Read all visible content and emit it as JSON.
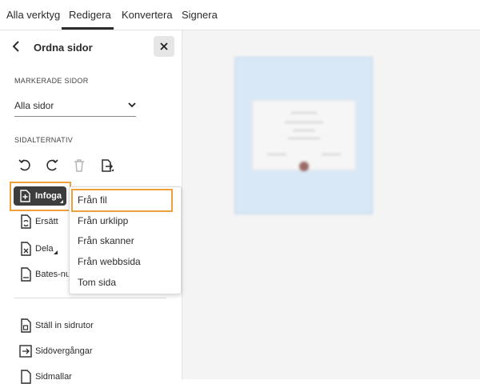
{
  "topnav": {
    "tabs": [
      {
        "label": "Alla verktyg"
      },
      {
        "label": "Redigera"
      },
      {
        "label": "Konvertera"
      },
      {
        "label": "Signera"
      }
    ],
    "active_tab": "Redigera"
  },
  "panel": {
    "title": "Ordna sidor",
    "selected_pages_label": "MARKERADE SIDOR",
    "selected_pages_value": "Alla sidor",
    "page_options_label": "SIDALTERNATIV",
    "tools": {
      "insert": "Infoga",
      "replace": "Ersätt",
      "split": "Dela",
      "bates": "Bates-nu",
      "page_boxes": "Ställ in sidrutor",
      "transitions": "Sidövergångar",
      "templates": "Sidmallar"
    }
  },
  "insert_menu": {
    "items": [
      {
        "label": "Från fil"
      },
      {
        "label": "Från urklipp"
      },
      {
        "label": "Från skanner"
      },
      {
        "label": "Från webbsida"
      },
      {
        "label": "Tom sida"
      }
    ]
  },
  "colors": {
    "highlight": "#f0a03a",
    "page_selected": "#d9e8f6",
    "button_dark": "#3d3d3d"
  }
}
